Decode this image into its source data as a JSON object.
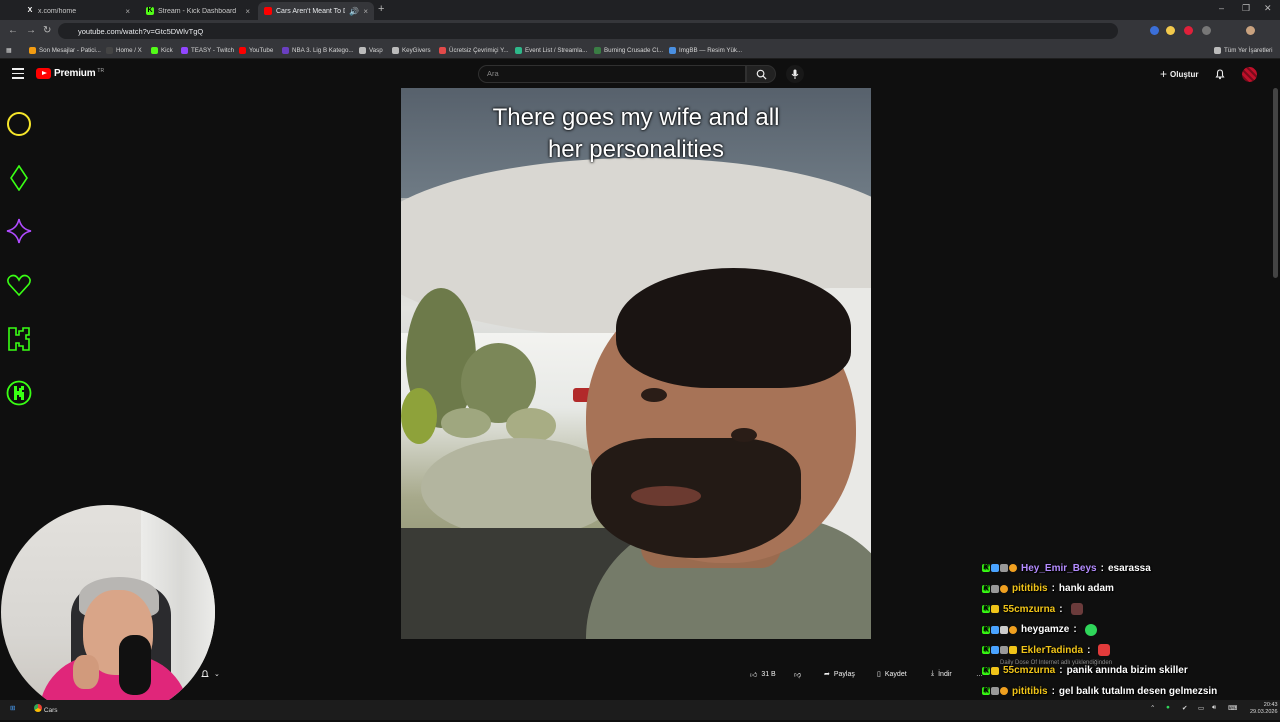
{
  "browser": {
    "tabs": [
      {
        "title": "x.com/home",
        "icon": "x-logo-icon"
      },
      {
        "title": "Stream - Kick Dashboard",
        "icon": "kick-logo-icon"
      },
      {
        "title": "Cars Aren't Meant To Do Th",
        "icon": "youtube-logo-icon"
      }
    ],
    "url": "youtube.com/watch?v=Gtc5DWlvTgQ",
    "bookmarks": [
      {
        "label": "Son Mesajlar - Patici..."
      },
      {
        "label": "Home / X"
      },
      {
        "label": "Kick"
      },
      {
        "label": "TEASY - Twitch"
      },
      {
        "label": "YouTube"
      },
      {
        "label": "NBA 3. Lig B Katego..."
      },
      {
        "label": "Vasp"
      },
      {
        "label": "KeyGivers"
      },
      {
        "label": "Ücretsiz Çevrimiçi Y..."
      },
      {
        "label": "Event List / Streamla..."
      },
      {
        "label": "Burning Crusade Cl..."
      },
      {
        "label": "ImgBB — Resim Yük..."
      }
    ],
    "all_bookmarks": "Tüm Yer İşaretleri"
  },
  "youtube": {
    "logo_text": "Premium",
    "logo_sup": "TR",
    "search_placeholder": "Ara",
    "create_label": "Oluştur"
  },
  "video": {
    "caption_line1": "There goes my wife and all",
    "caption_line2": "her personalities"
  },
  "actions": {
    "likes": "31 B",
    "share": "Paylaş",
    "save": "Kaydet",
    "download": "İndir"
  },
  "chat": [
    {
      "user": "Hey_Emir_Beys",
      "color": "#b48cff",
      "text": "esarassa",
      "emote_color": ""
    },
    {
      "user": "pititibis",
      "color": "#f0c419",
      "text": "hankı adam",
      "emote_color": ""
    },
    {
      "user": "55cmzurna",
      "color": "#f0c419",
      "text": "",
      "emote_color": "#6b3b3b"
    },
    {
      "user": "heygamze",
      "color": "#ffffff",
      "text": "",
      "emote_color": "#2fd65a"
    },
    {
      "user": "EklerTadinda",
      "color": "#f0c419",
      "text": "",
      "emote_color": "#e23b3b"
    },
    {
      "user": "55cmzurna",
      "color": "#f0c419",
      "text": "panik anında bizim skiller",
      "emote_color": ""
    },
    {
      "user": "pititibis",
      "color": "#f0c419",
      "text": "gel balık tutalım desen gelmezsin",
      "emote_color": ""
    },
    {
      "user": "heygamze",
      "color": "#ffffff",
      "text": "",
      "emote_color": "#b0604a"
    }
  ],
  "notification_text": "Daily Dose Of Internet adlı yüklendiğinden",
  "taskbar": {
    "app_label": "Cars",
    "time": "20:43",
    "date": "29.03.2026"
  },
  "colors": {
    "neon_yellow": "#f6e62a",
    "neon_green": "#39ff14",
    "neon_purple": "#b04bff",
    "youtube_red": "#ff0000"
  }
}
